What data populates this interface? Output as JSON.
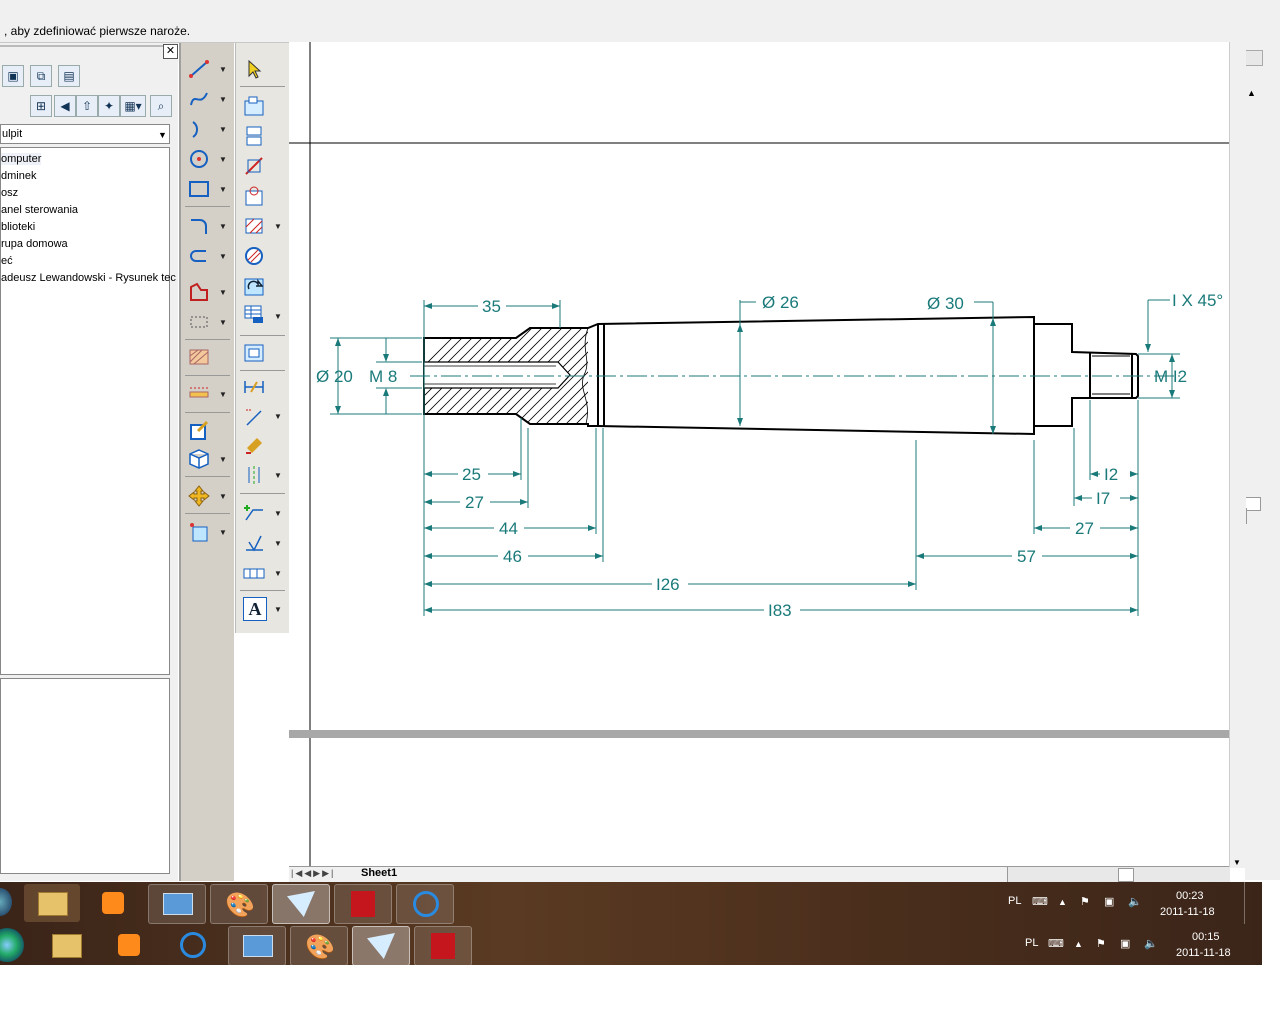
{
  "status": {
    "prompt": ", aby zdefiniować pierwsze naroże."
  },
  "explorer": {
    "location": "ulpit",
    "items": [
      {
        "label": "omputer"
      },
      {
        "label": "dminek"
      },
      {
        "label": "osz"
      },
      {
        "label": "anel sterowania"
      },
      {
        "label": "blioteki"
      },
      {
        "label": "rupa domowa"
      },
      {
        "label": "eć"
      },
      {
        "label": "adeusz Lewandowski - Rysunek tec"
      }
    ]
  },
  "drawing": {
    "dims": {
      "d35": "35",
      "d26": "Ø 26",
      "d30": "Ø 30",
      "chamfer": "I X 45°",
      "d20": "Ø 20",
      "m8": "M 8",
      "m12": "M I2",
      "d25": "25",
      "d27a": "27",
      "d44": "44",
      "d46": "46",
      "d126": "I26",
      "d183": "I83",
      "d12": "I2",
      "d17": "I7",
      "d27b": "27",
      "d57": "57"
    },
    "colors": {
      "dimension": "#1a7a7a",
      "outline": "#000000"
    }
  },
  "sheet": {
    "tab": "Sheet1"
  },
  "taskbar_top": {
    "lang": "PL",
    "time": "00:23",
    "date": "2011-11-18"
  },
  "taskbar_bottom": {
    "lang": "PL",
    "time": "00:15",
    "date": "2011-11-18"
  }
}
